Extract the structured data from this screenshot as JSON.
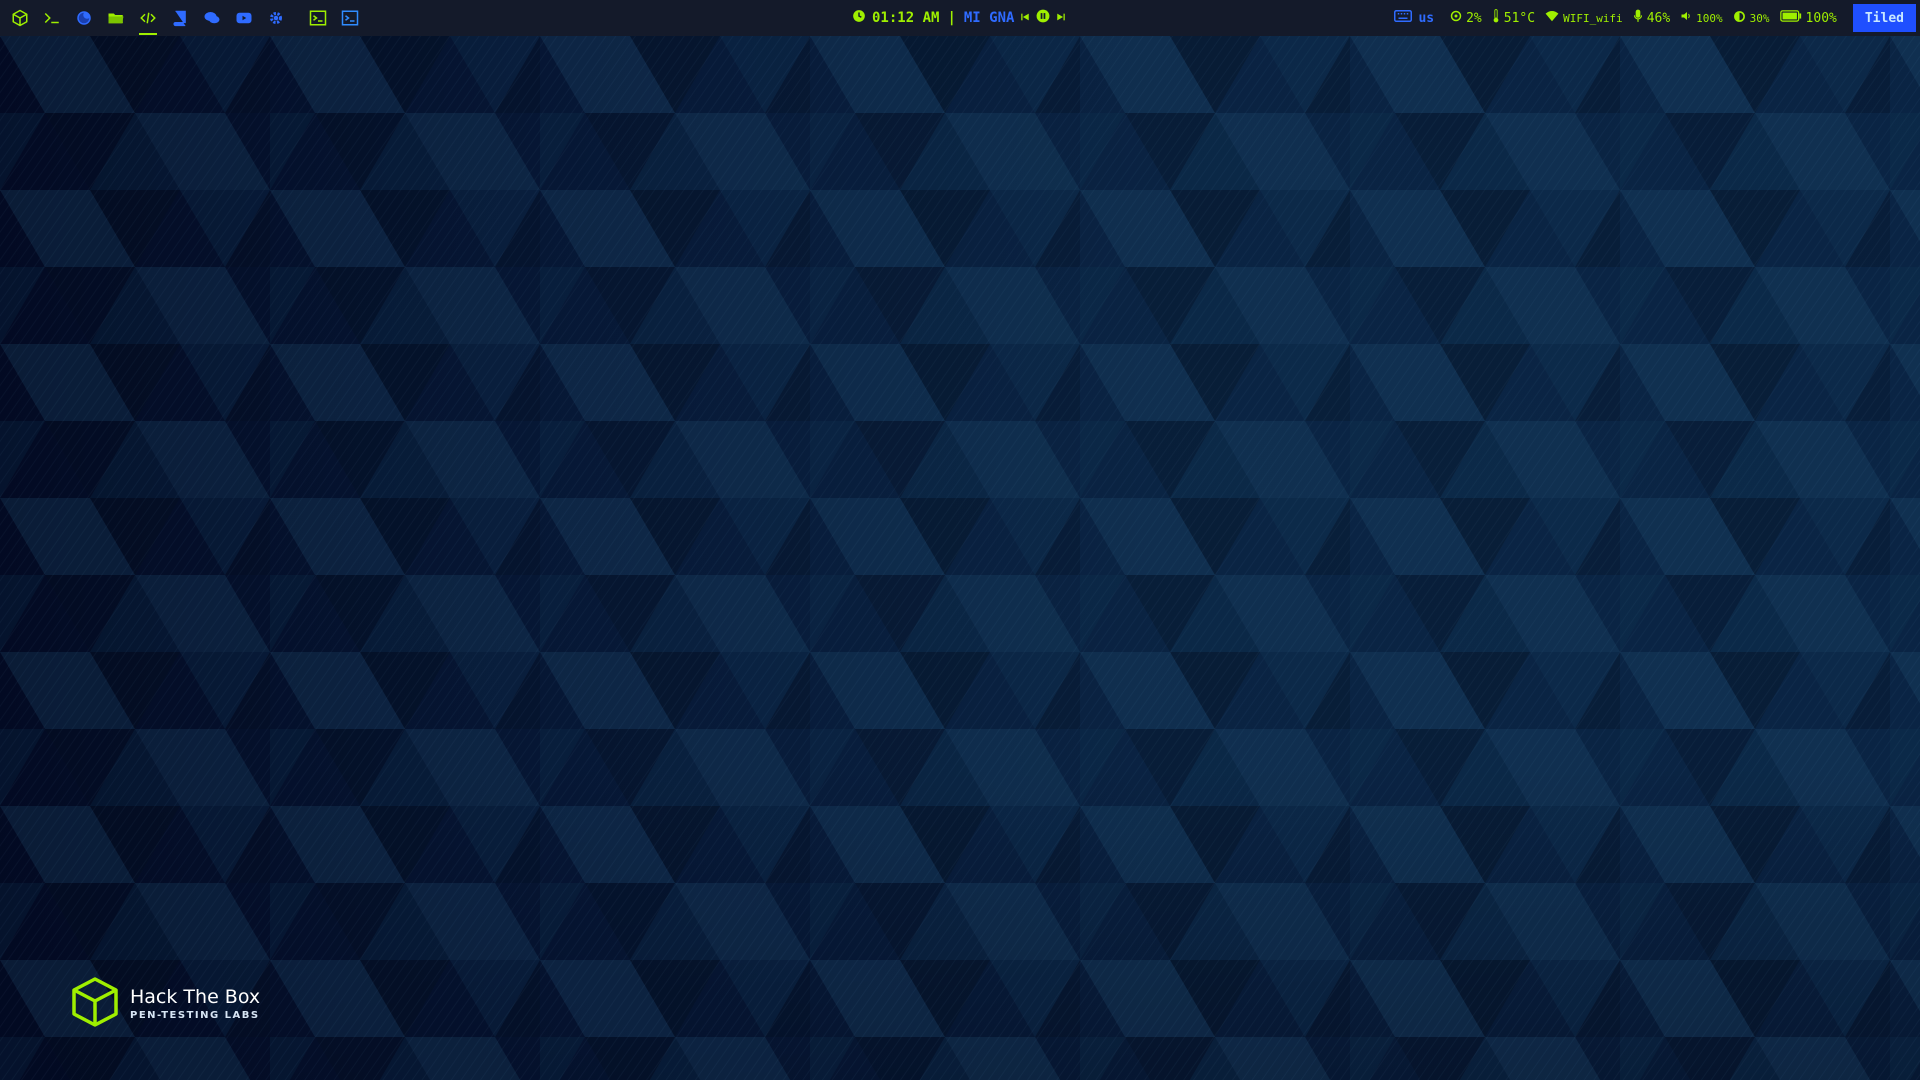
{
  "taskbar": {
    "launchers": [
      {
        "name": "htb-cube-icon",
        "color": "#9fef00"
      },
      {
        "name": "terminal-prompt-icon",
        "color": "#9fef00"
      },
      {
        "name": "firefox-icon",
        "color": "#2f6bff"
      },
      {
        "name": "folder-icon",
        "color": "#9fef00"
      },
      {
        "name": "code-icon",
        "color": "#9fef00",
        "active": true
      },
      {
        "name": "book-icon",
        "color": "#2f6bff"
      },
      {
        "name": "chat-icon",
        "color": "#2f6bff"
      },
      {
        "name": "video-icon",
        "color": "#2f6bff"
      },
      {
        "name": "settings-gear-icon",
        "color": "#2f6bff"
      },
      {
        "name": "terminal-window-icon",
        "color": "#9fef00"
      },
      {
        "name": "terminal-window-alt-icon",
        "color": "#2f8cff"
      }
    ],
    "clock": {
      "time": "01:12 AM"
    },
    "separator": "|",
    "media": {
      "title": "MI GNA"
    },
    "keyboard": {
      "layout": "us"
    },
    "stats": {
      "cpu": "2%",
      "temperature": "51°C",
      "wifi": "WIFI_wifi",
      "microphone": "46%",
      "volume": "100%",
      "brightness": "30%",
      "battery": "100%"
    },
    "layout_mode": "Tiled"
  },
  "desktop": {
    "logo": {
      "title": "Hack The Box",
      "subtitle": "PEN-TESTING LABS"
    }
  },
  "colors": {
    "accent_green": "#9fef00",
    "accent_blue": "#2f6bff",
    "bar_bg": "#141a2a",
    "wallpaper": "#0a2444"
  }
}
